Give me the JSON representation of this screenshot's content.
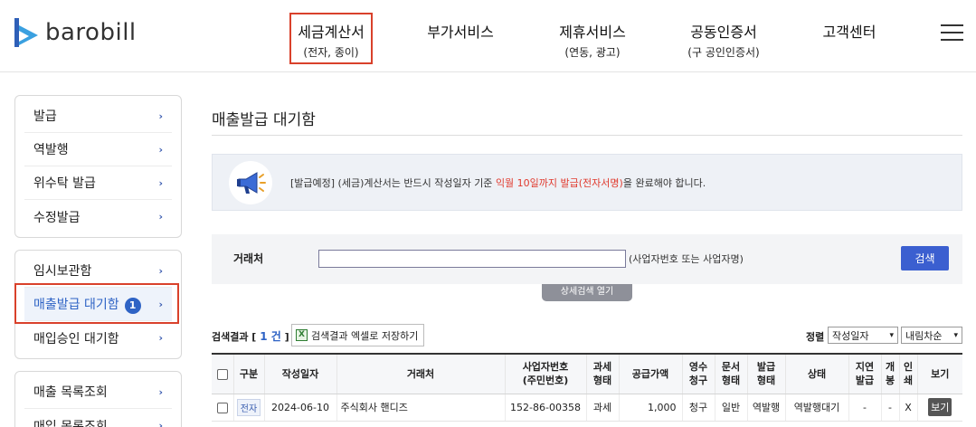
{
  "brand": {
    "name": "barobill"
  },
  "nav": [
    {
      "label": "세금계산서",
      "sub": "(전자, 종이)"
    },
    {
      "label": "부가서비스",
      "sub": ""
    },
    {
      "label": "제휴서비스",
      "sub": "(연동, 광고)"
    },
    {
      "label": "공동인증서",
      "sub": "(구 공인인증서)"
    },
    {
      "label": "고객센터",
      "sub": ""
    }
  ],
  "sidebar": {
    "group1": [
      "발급",
      "역발행",
      "위수탁 발급",
      "수정발급"
    ],
    "group2": [
      "임시보관함",
      "매출발급 대기함",
      "매입승인 대기함"
    ],
    "group2_badge": "1",
    "group3": [
      "매출 목록조회",
      "매입 목록조회"
    ]
  },
  "page": {
    "title": "매출발급 대기함"
  },
  "notice": {
    "before": "[발급예정] (세금)계산서는 반드시 작성일자 기준 ",
    "highlight": "익월 10일까지 발급(전자서명)",
    "after": "을 완료해야 합니다."
  },
  "search": {
    "label": "거래처",
    "value": "",
    "hint": "(사업자번호 또는 사업자명)",
    "button": "검색",
    "detail_toggle": "상세검색 열기"
  },
  "results": {
    "prefix": "검색결과 [",
    "count": "1 건",
    "suffix": "]",
    "excel_button": "검색결과 엑셀로 저장하기",
    "sort_label": "정렬",
    "sort_field": "작성일자",
    "sort_order": "내림차순"
  },
  "table": {
    "headers": [
      "",
      "구분",
      "작성일자",
      "거래처",
      "사업자번호\n(주민번호)",
      "과세\n형태",
      "공급가액",
      "영수\n청구",
      "문서\n형태",
      "발급\n형태",
      "상태",
      "지연\n발급",
      "개\n봉",
      "인\n쇄",
      "보기"
    ],
    "rows": [
      {
        "type": "전자",
        "date": "2024-06-10",
        "partner": "주식회사 핸디즈",
        "bizno": "152-86-00358",
        "tax": "과세",
        "amount": "1,000",
        "receipt": "청구",
        "doc": "일반",
        "issue": "역발행",
        "status": "역발행대기",
        "delay": "-",
        "open": "-",
        "print": "X",
        "view": "보기"
      }
    ]
  }
}
